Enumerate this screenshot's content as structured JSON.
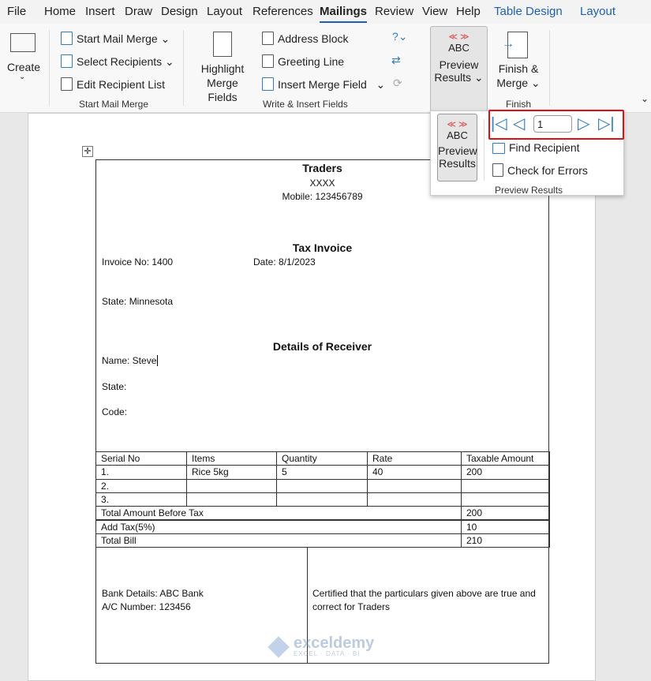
{
  "tabs": [
    "File",
    "Home",
    "Insert",
    "Draw",
    "Design",
    "Layout",
    "References",
    "Mailings",
    "Review",
    "View",
    "Help",
    "Table Design",
    "Layout"
  ],
  "ribbon": {
    "create": "Create",
    "start_mail_merge": "Start Mail Merge",
    "select_recipients": "Select Recipients",
    "edit_recipient_list": "Edit Recipient List",
    "group_start": "Start Mail Merge",
    "highlight1": "Highlight",
    "highlight2": "Merge Fields",
    "address_block": "Address Block",
    "greeting_line": "Greeting Line",
    "insert_merge_field": "Insert Merge Field",
    "group_write": "Write & Insert Fields",
    "abc": "ABC",
    "preview1": "Preview",
    "preview2": "Results",
    "finish1": "Finish &",
    "finish2": "Merge",
    "group_finish": "Finish"
  },
  "preview_dropdown": {
    "abc": "ABC",
    "preview1": "Preview",
    "preview2": "Results",
    "record_number": "1",
    "find_recipient": "Find Recipient",
    "check_errors": "Check for Errors",
    "group": "Preview Results"
  },
  "doc": {
    "company": "Traders",
    "xxxx": "XXXX",
    "mobile": "Mobile: 123456789",
    "tax_invoice": "Tax Invoice",
    "invoice_no": "Invoice No: 1400",
    "date": "Date: 8/1/2023",
    "state_top": "State: Minnesota",
    "details": "Details of Receiver",
    "name": "Name: Steve",
    "state": "State:",
    "code": "Code:",
    "headers": [
      "Serial No",
      "Items",
      "Quantity",
      "Rate",
      "Taxable Amount"
    ],
    "rows": [
      [
        "1.",
        "Rice 5kg",
        "5",
        "40",
        "200"
      ],
      [
        "2.",
        "",
        "",
        "",
        ""
      ],
      [
        "3.",
        "",
        "",
        "",
        ""
      ]
    ],
    "total_before_label": "Total Amount Before Tax",
    "total_before": "200",
    "tax_label": "Add Tax(5%)",
    "tax": "10",
    "total_label": "Total Bill",
    "total": "210",
    "bank": "Bank Details: ABC Bank",
    "acc": "A/C Number: 123456",
    "cert1": "Certified that the particulars given above are true and",
    "cert2": "correct for Traders"
  },
  "watermark": {
    "name": "exceldemy",
    "tag": "EXCEL · DATA · BI"
  }
}
